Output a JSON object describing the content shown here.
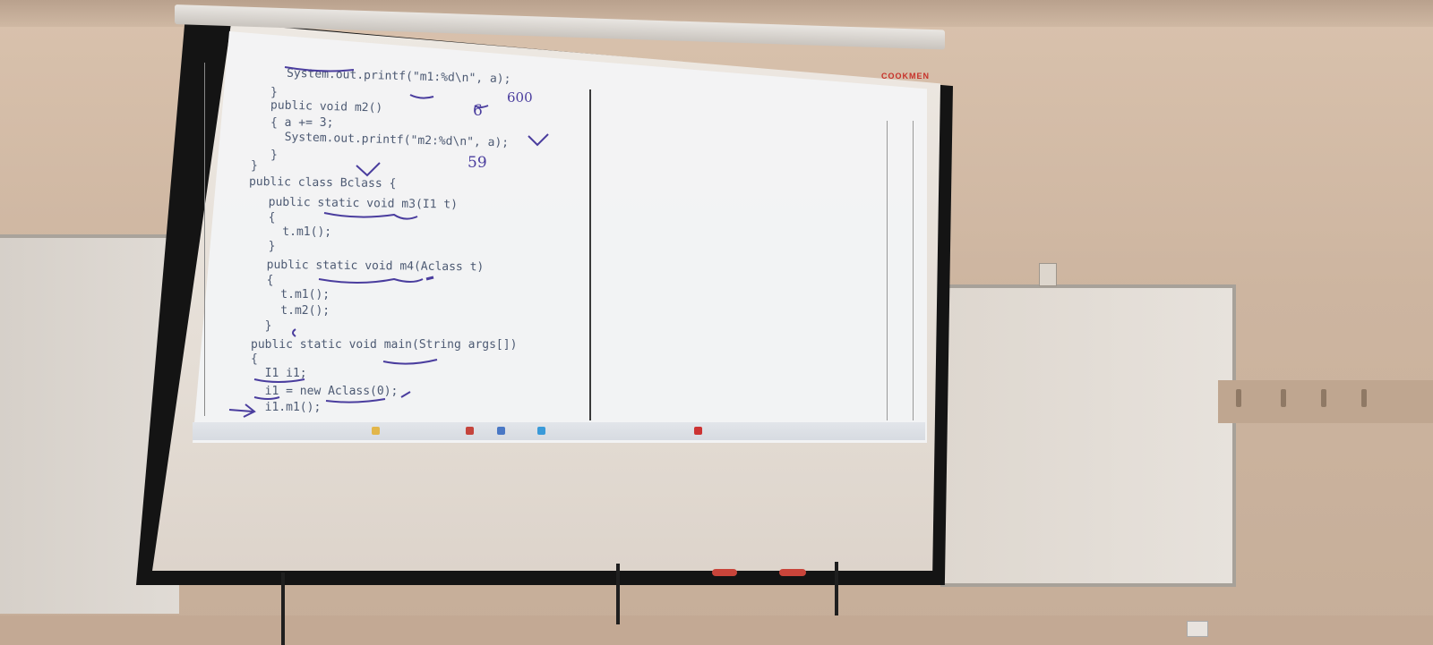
{
  "projector": {
    "brand": "COOKMEN"
  },
  "code_lines": [
    "System.out.printf(\"m1:%d\\n\", a);",
    "}",
    "public void m2()",
    "{ a += 3;",
    "  System.out.printf(\"m2:%d\\n\", a);",
    "}",
    "}",
    "public class Bclass {",
    "  public static void m3(I1 t)",
    "  {",
    "    t.m1();",
    "  }",
    "  public static void m4(Aclass t)",
    "  {",
    "    t.m1();",
    "    t.m2();",
    "  }",
    "public static void main(String args[])",
    "{",
    "  I1 i1;",
    "  i1 = new Aclass(0);",
    "  i1.m1();"
  ],
  "handwriting": {
    "note_a": "600",
    "note_b": "59",
    "note_c": "6"
  },
  "colors": {
    "ink": "#4a3d9e",
    "code": "#4d5a73"
  }
}
